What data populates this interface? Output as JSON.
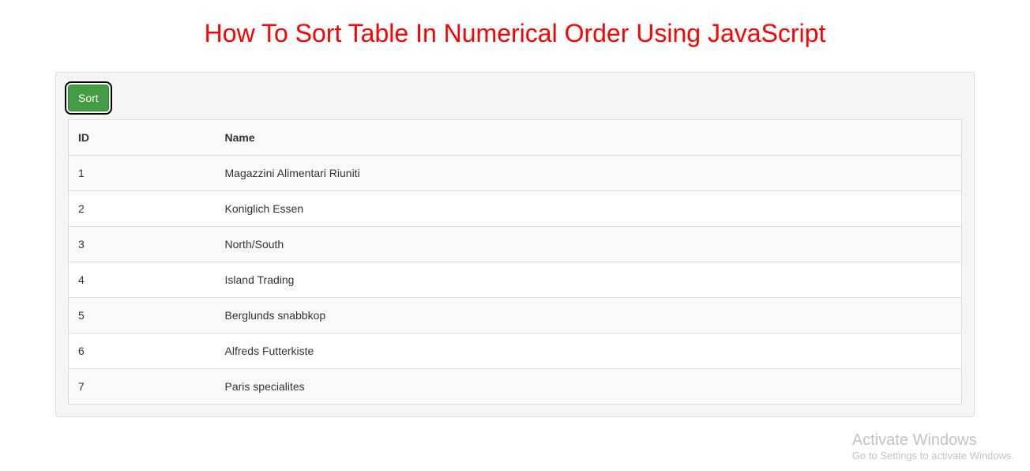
{
  "header": {
    "title": "How To Sort Table In Numerical Order Using JavaScript"
  },
  "controls": {
    "sort_label": "Sort"
  },
  "table": {
    "headers": {
      "id": "ID",
      "name": "Name"
    },
    "rows": [
      {
        "id": "1",
        "name": "Magazzini Alimentari Riuniti"
      },
      {
        "id": "2",
        "name": "Koniglich Essen"
      },
      {
        "id": "3",
        "name": "North/South"
      },
      {
        "id": "4",
        "name": "Island Trading"
      },
      {
        "id": "5",
        "name": "Berglunds snabbkop"
      },
      {
        "id": "6",
        "name": "Alfreds Futterkiste"
      },
      {
        "id": "7",
        "name": "Paris specialites"
      }
    ]
  },
  "watermark": {
    "title": "Activate Windows",
    "subtitle": "Go to Settings to activate Windows."
  }
}
